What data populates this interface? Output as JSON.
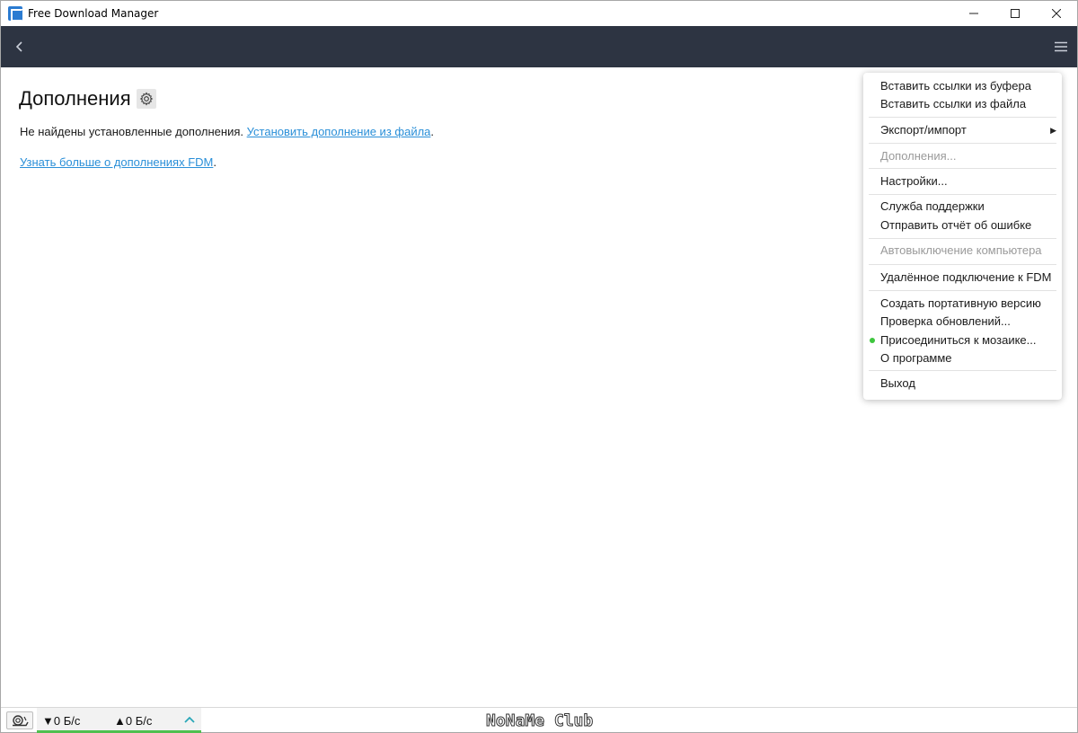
{
  "window": {
    "title": "Free Download Manager",
    "controls": {
      "minimize": "minimize-icon",
      "maximize": "maximize-icon",
      "close": "close-icon"
    }
  },
  "toolbar": {
    "back_icon": "back-arrow-icon",
    "menu_icon": "hamburger-menu-icon",
    "background": "#2d3442"
  },
  "page": {
    "title": "Дополнения",
    "settings_icon": "gear-icon",
    "no_addons_text": "Не найдены установленные дополнения.",
    "install_link": "Установить дополнение из файла",
    "install_suffix": ".",
    "learn_link": "Узнать больше о дополнениях FDM",
    "learn_suffix": ".",
    "link_color": "#2a8fd8"
  },
  "menu": {
    "items": [
      {
        "label": "Вставить ссылки из буфера",
        "enabled": true
      },
      {
        "label": "Вставить ссылки из файла",
        "enabled": true
      },
      {
        "label": "Экспорт/импорт",
        "enabled": true,
        "submenu": true
      },
      {
        "label": "Дополнения...",
        "enabled": false
      },
      {
        "label": "Настройки...",
        "enabled": true
      },
      {
        "label": "Служба поддержки",
        "enabled": true
      },
      {
        "label": "Отправить отчёт об ошибке",
        "enabled": true
      },
      {
        "label": "Автовыключение компьютера",
        "enabled": false
      },
      {
        "label": "Удалённое подключение к FDM",
        "enabled": true
      },
      {
        "label": "Создать портативную версию",
        "enabled": true
      },
      {
        "label": "Проверка обновлений...",
        "enabled": true
      },
      {
        "label": "Присоединиться к мозаике...",
        "enabled": true,
        "indicator": "green-dot"
      },
      {
        "label": "О программе",
        "enabled": true
      },
      {
        "label": "Выход",
        "enabled": true
      }
    ]
  },
  "statusbar": {
    "snail_icon": "snail-icon",
    "download_speed": "▼0 Б/с",
    "upload_speed": "▲0 Б/с",
    "expand_icon": "chevron-up-icon",
    "accent": "#4fbf4f",
    "watermark": "NoNaMe Club"
  }
}
